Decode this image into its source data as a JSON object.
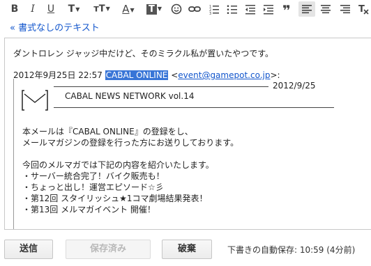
{
  "toolbar": {
    "bold": "B",
    "italic": "I",
    "underline": "U",
    "font": "T",
    "size": "тT",
    "color": "A",
    "bgcolor": "T"
  },
  "plain_text_link": "« 書式なしのテキスト",
  "body": {
    "line1": "ダントロレン ジャッジ中だけど、そのミラクル私が置いたやつです。",
    "quote_header_prefix": "2012年9月25日 22:57 ",
    "quote_sender_name": "CABAL ONLINE",
    "quote_lt": " <",
    "quote_email": "event@gamepot.co.jp",
    "quote_suffix": ">:",
    "newsletter_date": "2012/9/25",
    "newsletter_title": "CABAL NEWS NETWORK vol.14",
    "para1_line1": "本メールは『CABAL ONLINE』の登録をし、",
    "para1_line2": "メールマガジンの登録を行った方にお送りしております。",
    "para2_intro": "今回のメルマガでは下記の内容を紹介いたします。",
    "items": [
      "・サーバー統合完了！バイク販売も！",
      "・ちょっと出し！運営エピソード☆彡",
      "・第12回 スタイリッシュ★1コマ劇場結果発表！",
      "・第13回 メルマガイベント 開催！"
    ]
  },
  "buttons": {
    "send": "送信",
    "save": "保存済み",
    "discard": "破棄"
  },
  "autosave": "下書きの自動保存: 10:59 (4分前)"
}
